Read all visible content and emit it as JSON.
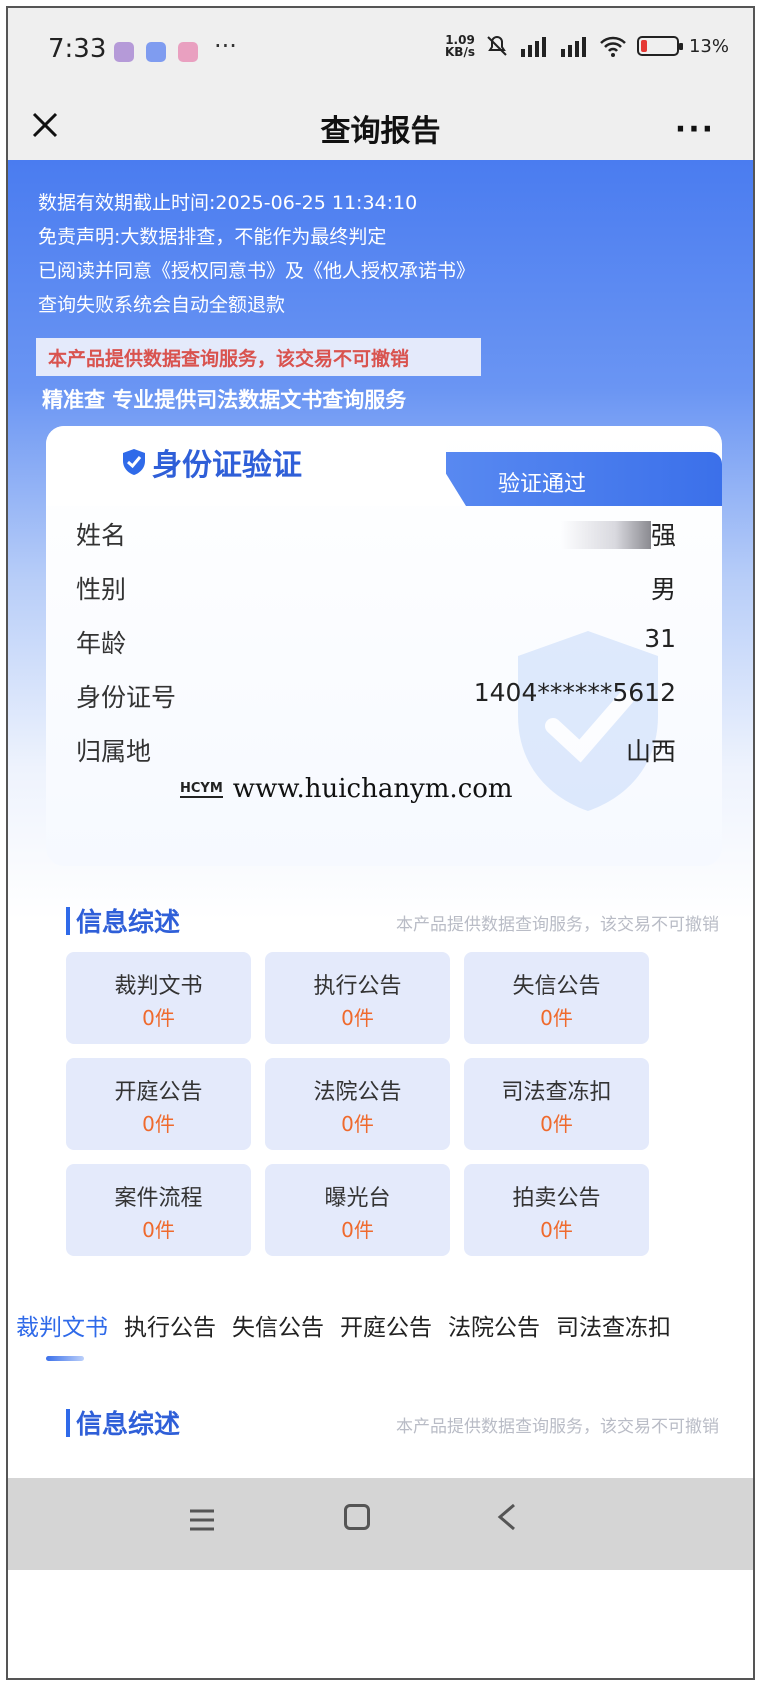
{
  "status_bar": {
    "time": "7:33",
    "more": "···",
    "speed_value": "1.09",
    "speed_unit": "KB/s",
    "battery": "13%"
  },
  "title_bar": {
    "title": "查询报告",
    "more": "···"
  },
  "notices": {
    "line1": "数据有效期截止时间:2025-06-25 11:34:10",
    "line2": "免责声明:大数据排查，不能作为最终判定",
    "line3": "已阅读并同意《授权同意书》及《他人授权承诺书》",
    "line4": "查询失败系统会自动全额退款",
    "warning": "本产品提供数据查询服务，该交易不可撤销",
    "slogan": "精准查  专业提供司法数据文书查询服务"
  },
  "id_card": {
    "title": "身份证验证",
    "status": "验证通过",
    "rows": [
      {
        "label": "姓名",
        "value": "强"
      },
      {
        "label": "性别",
        "value": "男"
      },
      {
        "label": "年龄",
        "value": "31"
      },
      {
        "label": "身份证号",
        "value": "1404******5612"
      },
      {
        "label": "归属地",
        "value": "山西"
      }
    ]
  },
  "watermark": {
    "logo": "HCYM",
    "url": "www.huichanym.com"
  },
  "summary": {
    "title": "信息综述",
    "note": "本产品提供数据查询服务，该交易不可撤销",
    "tiles": [
      {
        "label": "裁判文书",
        "count": "0件"
      },
      {
        "label": "执行公告",
        "count": "0件"
      },
      {
        "label": "失信公告",
        "count": "0件"
      },
      {
        "label": "开庭公告",
        "count": "0件"
      },
      {
        "label": "法院公告",
        "count": "0件"
      },
      {
        "label": "司法查冻扣",
        "count": "0件"
      },
      {
        "label": "案件流程",
        "count": "0件"
      },
      {
        "label": "曝光台",
        "count": "0件"
      },
      {
        "label": "拍卖公告",
        "count": "0件"
      }
    ]
  },
  "tabs": [
    "裁判文书",
    "执行公告",
    "失信公告",
    "开庭公告",
    "法院公告",
    "司法查冻扣"
  ],
  "summary2": {
    "title": "信息综述",
    "note": "本产品提供数据查询服务，该交易不可撤销"
  },
  "colors": {
    "accent": "#2f6ae9",
    "warning": "#d9534f",
    "count": "#ef6a2d",
    "tile_bg": "#e4eafb"
  }
}
